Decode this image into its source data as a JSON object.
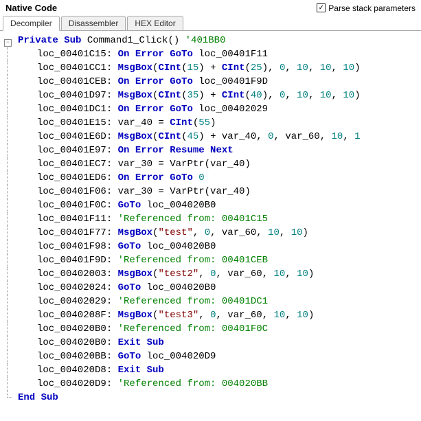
{
  "header": {
    "title": "Native Code",
    "checkbox_label": "Parse stack parameters",
    "checkbox_checked": true
  },
  "tabs": [
    {
      "label": "Decompiler",
      "active": true
    },
    {
      "label": "Disassembler",
      "active": false
    },
    {
      "label": "HEX Editor",
      "active": false
    }
  ],
  "code": {
    "sub_decl_kw1": "Private Sub",
    "sub_name": "Command1_Click()",
    "sub_addr": "'401BB0",
    "lines": [
      {
        "loc": "loc_00401C15:",
        "parts": [
          {
            "t": "kw",
            "v": "On Error GoTo"
          },
          {
            "t": "plain",
            "v": " loc_00401F11"
          }
        ]
      },
      {
        "loc": "loc_00401CC1:",
        "parts": [
          {
            "t": "fn",
            "v": "MsgBox"
          },
          {
            "t": "plain",
            "v": "("
          },
          {
            "t": "fn",
            "v": "CInt"
          },
          {
            "t": "plain",
            "v": "("
          },
          {
            "t": "num",
            "v": "15"
          },
          {
            "t": "plain",
            "v": ") + "
          },
          {
            "t": "fn",
            "v": "CInt"
          },
          {
            "t": "plain",
            "v": "("
          },
          {
            "t": "num",
            "v": "25"
          },
          {
            "t": "plain",
            "v": "), "
          },
          {
            "t": "num",
            "v": "0"
          },
          {
            "t": "plain",
            "v": ", "
          },
          {
            "t": "num",
            "v": "10"
          },
          {
            "t": "plain",
            "v": ", "
          },
          {
            "t": "num",
            "v": "10"
          },
          {
            "t": "plain",
            "v": ", "
          },
          {
            "t": "num",
            "v": "10"
          },
          {
            "t": "plain",
            "v": ")"
          }
        ]
      },
      {
        "loc": "loc_00401CEB:",
        "parts": [
          {
            "t": "kw",
            "v": "On Error GoTo"
          },
          {
            "t": "plain",
            "v": " loc_00401F9D"
          }
        ]
      },
      {
        "loc": "loc_00401D97:",
        "parts": [
          {
            "t": "fn",
            "v": "MsgBox"
          },
          {
            "t": "plain",
            "v": "("
          },
          {
            "t": "fn",
            "v": "CInt"
          },
          {
            "t": "plain",
            "v": "("
          },
          {
            "t": "num",
            "v": "35"
          },
          {
            "t": "plain",
            "v": ") + "
          },
          {
            "t": "fn",
            "v": "CInt"
          },
          {
            "t": "plain",
            "v": "("
          },
          {
            "t": "num",
            "v": "40"
          },
          {
            "t": "plain",
            "v": "), "
          },
          {
            "t": "num",
            "v": "0"
          },
          {
            "t": "plain",
            "v": ", "
          },
          {
            "t": "num",
            "v": "10"
          },
          {
            "t": "plain",
            "v": ", "
          },
          {
            "t": "num",
            "v": "10"
          },
          {
            "t": "plain",
            "v": ", "
          },
          {
            "t": "num",
            "v": "10"
          },
          {
            "t": "plain",
            "v": ")"
          }
        ]
      },
      {
        "loc": "loc_00401DC1:",
        "parts": [
          {
            "t": "kw",
            "v": "On Error GoTo"
          },
          {
            "t": "plain",
            "v": " loc_00402029"
          }
        ]
      },
      {
        "loc": "loc_00401E15:",
        "parts": [
          {
            "t": "plain",
            "v": "var_40 = "
          },
          {
            "t": "fn",
            "v": "CInt"
          },
          {
            "t": "plain",
            "v": "("
          },
          {
            "t": "num",
            "v": "55"
          },
          {
            "t": "plain",
            "v": ")"
          }
        ]
      },
      {
        "loc": "loc_00401E6D:",
        "parts": [
          {
            "t": "fn",
            "v": "MsgBox"
          },
          {
            "t": "plain",
            "v": "("
          },
          {
            "t": "fn",
            "v": "CInt"
          },
          {
            "t": "plain",
            "v": "("
          },
          {
            "t": "num",
            "v": "45"
          },
          {
            "t": "plain",
            "v": ") + var_40, "
          },
          {
            "t": "num",
            "v": "0"
          },
          {
            "t": "plain",
            "v": ", var_60, "
          },
          {
            "t": "num",
            "v": "10"
          },
          {
            "t": "plain",
            "v": ", "
          },
          {
            "t": "num",
            "v": "1"
          }
        ]
      },
      {
        "loc": "loc_00401E97:",
        "parts": [
          {
            "t": "kw",
            "v": "On Error Resume Next"
          }
        ]
      },
      {
        "loc": "loc_00401EC7:",
        "parts": [
          {
            "t": "plain",
            "v": "var_30 = VarPtr(var_40)"
          }
        ]
      },
      {
        "loc": "loc_00401ED6:",
        "parts": [
          {
            "t": "kw",
            "v": "On Error GoTo"
          },
          {
            "t": "plain",
            "v": " "
          },
          {
            "t": "num",
            "v": "0"
          }
        ]
      },
      {
        "loc": "loc_00401F06:",
        "parts": [
          {
            "t": "plain",
            "v": "var_30 = VarPtr(var_40)"
          }
        ]
      },
      {
        "loc": "loc_00401F0C:",
        "parts": [
          {
            "t": "kw",
            "v": "GoTo"
          },
          {
            "t": "plain",
            "v": " loc_004020B0"
          }
        ]
      },
      {
        "loc": "loc_00401F11:",
        "parts": [
          {
            "t": "cmt",
            "v": "'Referenced from: 00401C15"
          }
        ]
      },
      {
        "loc": "loc_00401F77:",
        "parts": [
          {
            "t": "fn",
            "v": "MsgBox"
          },
          {
            "t": "plain",
            "v": "("
          },
          {
            "t": "str",
            "v": "\"test\""
          },
          {
            "t": "plain",
            "v": ", "
          },
          {
            "t": "num",
            "v": "0"
          },
          {
            "t": "plain",
            "v": ", var_60, "
          },
          {
            "t": "num",
            "v": "10"
          },
          {
            "t": "plain",
            "v": ", "
          },
          {
            "t": "num",
            "v": "10"
          },
          {
            "t": "plain",
            "v": ")"
          }
        ]
      },
      {
        "loc": "loc_00401F98:",
        "parts": [
          {
            "t": "kw",
            "v": "GoTo"
          },
          {
            "t": "plain",
            "v": " loc_004020B0"
          }
        ]
      },
      {
        "loc": "loc_00401F9D:",
        "parts": [
          {
            "t": "cmt",
            "v": "'Referenced from: 00401CEB"
          }
        ]
      },
      {
        "loc": "loc_00402003:",
        "parts": [
          {
            "t": "fn",
            "v": "MsgBox"
          },
          {
            "t": "plain",
            "v": "("
          },
          {
            "t": "str",
            "v": "\"test2\""
          },
          {
            "t": "plain",
            "v": ", "
          },
          {
            "t": "num",
            "v": "0"
          },
          {
            "t": "plain",
            "v": ", var_60, "
          },
          {
            "t": "num",
            "v": "10"
          },
          {
            "t": "plain",
            "v": ", "
          },
          {
            "t": "num",
            "v": "10"
          },
          {
            "t": "plain",
            "v": ")"
          }
        ]
      },
      {
        "loc": "loc_00402024:",
        "parts": [
          {
            "t": "kw",
            "v": "GoTo"
          },
          {
            "t": "plain",
            "v": " loc_004020B0"
          }
        ]
      },
      {
        "loc": "loc_00402029:",
        "parts": [
          {
            "t": "cmt",
            "v": "'Referenced from: 00401DC1"
          }
        ]
      },
      {
        "loc": "loc_0040208F:",
        "parts": [
          {
            "t": "fn",
            "v": "MsgBox"
          },
          {
            "t": "plain",
            "v": "("
          },
          {
            "t": "str",
            "v": "\"test3\""
          },
          {
            "t": "plain",
            "v": ", "
          },
          {
            "t": "num",
            "v": "0"
          },
          {
            "t": "plain",
            "v": ", var_60, "
          },
          {
            "t": "num",
            "v": "10"
          },
          {
            "t": "plain",
            "v": ", "
          },
          {
            "t": "num",
            "v": "10"
          },
          {
            "t": "plain",
            "v": ")"
          }
        ]
      },
      {
        "loc": "loc_004020B0:",
        "parts": [
          {
            "t": "cmt",
            "v": "'Referenced from: 00401F0C"
          }
        ]
      },
      {
        "loc": "loc_004020B0:",
        "parts": [
          {
            "t": "kw",
            "v": "Exit Sub"
          }
        ]
      },
      {
        "loc": "loc_004020BB:",
        "parts": [
          {
            "t": "kw",
            "v": "GoTo"
          },
          {
            "t": "plain",
            "v": " loc_004020D9"
          }
        ]
      },
      {
        "loc": "loc_004020D8:",
        "parts": [
          {
            "t": "kw",
            "v": "Exit Sub"
          }
        ]
      },
      {
        "loc": "loc_004020D9:",
        "parts": [
          {
            "t": "cmt",
            "v": "'Referenced from: 004020BB"
          }
        ]
      }
    ],
    "end_sub": "End Sub"
  }
}
